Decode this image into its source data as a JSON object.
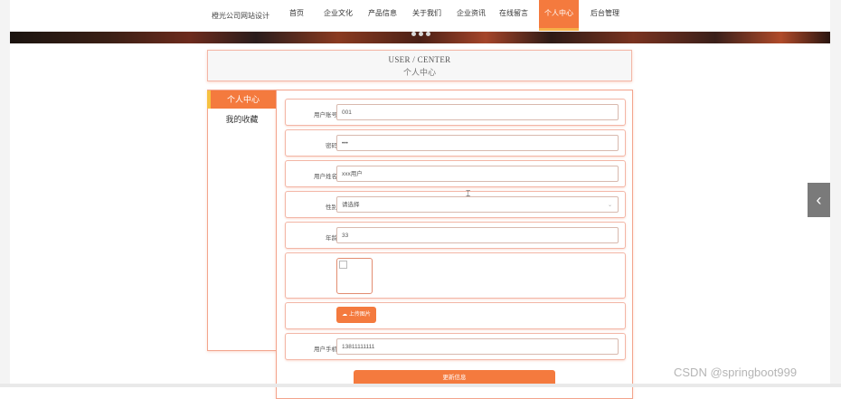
{
  "nav": {
    "brand": "橙光公司网站设计",
    "items": [
      "首页",
      "企业文化",
      "产品信息",
      "关于我们",
      "企业资讯",
      "在线留言",
      "个人中心",
      "后台管理"
    ],
    "active": "个人中心"
  },
  "heading": {
    "en": "USER / CENTER",
    "cn": "个人中心"
  },
  "sidebar": {
    "items": [
      "个人中心",
      "我的收藏"
    ],
    "active": "个人中心"
  },
  "form": {
    "fields": [
      {
        "label": "用户账号",
        "value": "001"
      },
      {
        "label": "密码",
        "value": "•••"
      },
      {
        "label": "用户姓名",
        "value": "xxx用户"
      },
      {
        "label": "性别",
        "value": "请选择"
      },
      {
        "label": "年龄",
        "value": "33"
      },
      {
        "label": "用户手机",
        "value": "13811111111"
      }
    ],
    "upload_label": "上传图片",
    "submit_label": "更新信息"
  },
  "icons": {
    "upload": "cloud-upload-icon",
    "select": "chevron-down-icon",
    "side_arrow": "chevron-left-icon"
  },
  "colors": {
    "accent": "#f47a3e",
    "accent_secondary": "#f6b24a"
  },
  "watermark": "CSDN @springboot999"
}
